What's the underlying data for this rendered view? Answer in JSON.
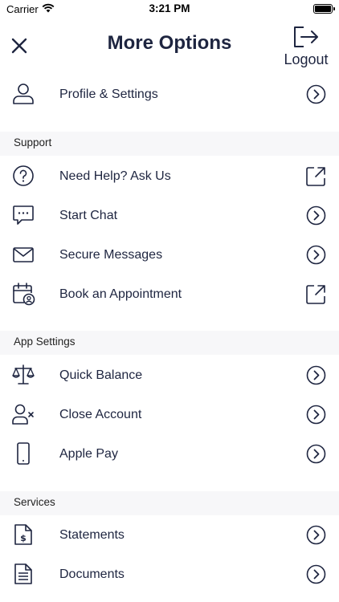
{
  "status_bar": {
    "carrier": "Carrier",
    "time": "3:21 PM"
  },
  "header": {
    "title": "More Options",
    "logout_label": "Logout"
  },
  "top_items": [
    {
      "label": "Profile & Settings",
      "icon": "user-icon",
      "action": "chevron-right-icon"
    }
  ],
  "sections": [
    {
      "title": "Support",
      "items": [
        {
          "label": "Need Help? Ask Us",
          "icon": "question-circle-icon",
          "action": "external-link-icon"
        },
        {
          "label": "Start Chat",
          "icon": "chat-bubble-icon",
          "action": "chevron-right-icon"
        },
        {
          "label": "Secure Messages",
          "icon": "envelope-icon",
          "action": "chevron-right-icon"
        },
        {
          "label": "Book an Appointment",
          "icon": "calendar-user-icon",
          "action": "external-link-icon"
        }
      ]
    },
    {
      "title": "App Settings",
      "items": [
        {
          "label": "Quick Balance",
          "icon": "scale-icon",
          "action": "chevron-right-icon"
        },
        {
          "label": "Close Account",
          "icon": "user-remove-icon",
          "action": "chevron-right-icon"
        },
        {
          "label": "Apple Pay",
          "icon": "phone-icon",
          "action": "chevron-right-icon"
        }
      ]
    },
    {
      "title": "Services",
      "items": [
        {
          "label": "Statements",
          "icon": "statement-dollar-icon",
          "action": "chevron-right-icon"
        },
        {
          "label": "Documents",
          "icon": "document-icon",
          "action": "chevron-right-icon"
        }
      ]
    }
  ],
  "colors": {
    "text": "#1e2540",
    "section_bg": "#f7f7f9"
  }
}
